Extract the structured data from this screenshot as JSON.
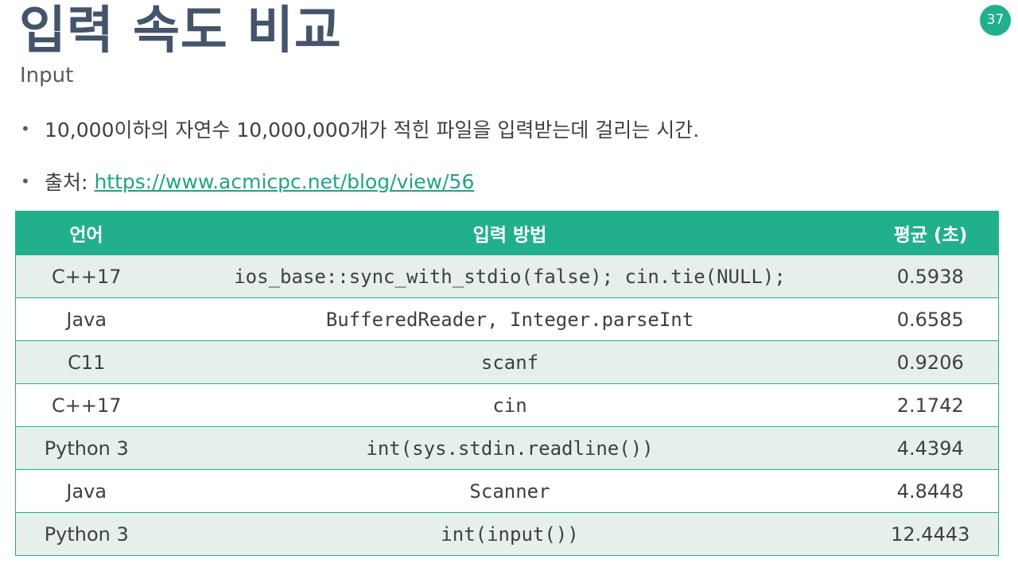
{
  "slide": {
    "title": "입력 속도 비교",
    "subtitle": "Input",
    "page_number": "37"
  },
  "bullets": [
    {
      "text": "10,000이하의 자연수 10,000,000개가 적힌 파일을 입력받는데 걸리는 시간."
    },
    {
      "label": "출처:",
      "link": "https://www.acmicpc.net/blog/view/56"
    }
  ],
  "table": {
    "headers": [
      "언어",
      "입력 방법",
      "평균 (초)"
    ],
    "rows": [
      [
        "C++17",
        "ios_base::sync_with_stdio(false); cin.tie(NULL);",
        "0.5938"
      ],
      [
        "Java",
        "BufferedReader, Integer.parseInt",
        "0.6585"
      ],
      [
        "C11",
        "scanf",
        "0.9206"
      ],
      [
        "C++17",
        "cin",
        "2.1742"
      ],
      [
        "Python 3",
        "int(sys.stdin.readline())",
        "4.4394"
      ],
      [
        "Java",
        "Scanner",
        "4.8448"
      ],
      [
        "Python 3",
        "int(input())",
        "12.4443"
      ]
    ]
  },
  "colors": {
    "accent": "#22b08c",
    "title": "#44546a",
    "row_shade": "#e6f0eb",
    "link": "#22a386"
  }
}
